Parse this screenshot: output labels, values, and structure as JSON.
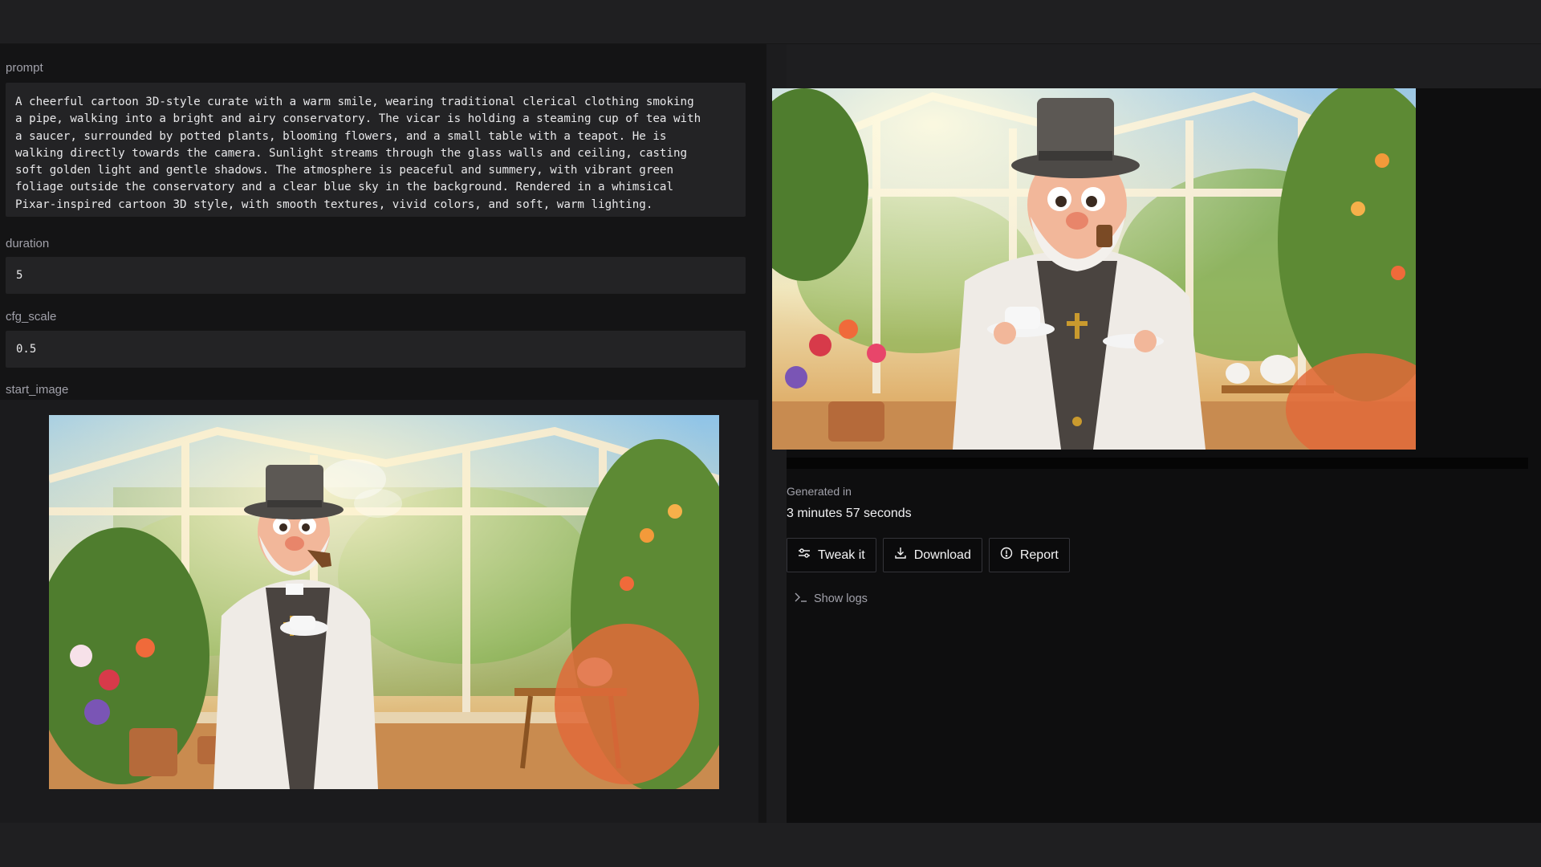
{
  "form": {
    "prompt_label": "prompt",
    "prompt_value": "A cheerful cartoon 3D-style curate with a warm smile, wearing traditional clerical clothing smoking\na pipe, walking into a bright and airy conservatory. The vicar is holding a steaming cup of tea with\na saucer, surrounded by potted plants, blooming flowers, and a small table with a teapot. He is\nwalking directly towards the camera. Sunlight streams through the glass walls and ceiling, casting\nsoft golden light and gentle shadows. The atmosphere is peaceful and summery, with vibrant green\nfoliage outside the conservatory and a clear blue sky in the background. Rendered in a whimsical\nPixar-inspired cartoon 3D style, with smooth textures, vivid colors, and soft, warm lighting.",
    "duration_label": "duration",
    "duration_value": "5",
    "cfg_label": "cfg_scale",
    "cfg_value": "0.5",
    "start_image_label": "start_image"
  },
  "result": {
    "generated_label": "Generated in",
    "generated_value": "3 minutes 57 seconds",
    "buttons": {
      "tweak": "Tweak it",
      "download": "Download",
      "report": "Report"
    },
    "show_logs": "Show logs"
  },
  "icons": {
    "tweak": "sliders-icon",
    "download": "download-icon",
    "report": "info-circle-icon",
    "logs": "terminal-icon"
  },
  "colors": {
    "background": "#141415",
    "panel": "#0e0e0f",
    "field": "#232325",
    "text": "#e4e4e7",
    "muted": "#a1a1aa"
  }
}
